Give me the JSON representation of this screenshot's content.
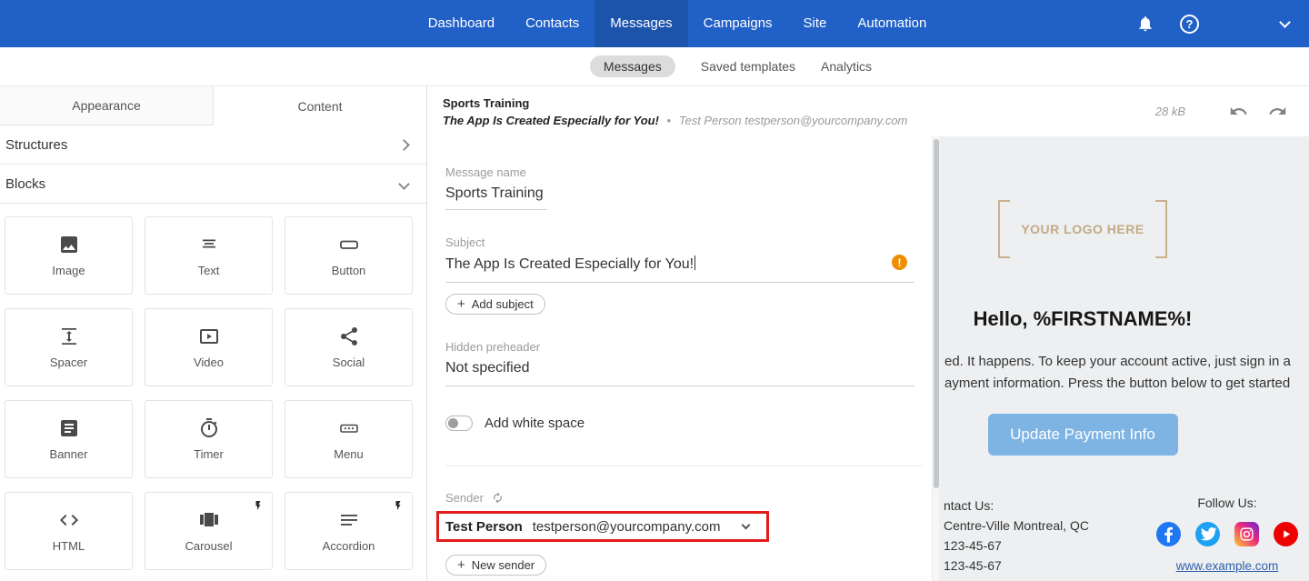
{
  "colors": {
    "topnav_bg": "#2160c7",
    "topnav_active_bg": "#1c53ab",
    "active_pill_bg": "#dcdcdc",
    "warning_orange": "#ef8e00",
    "highlight_red": "#e31b1b",
    "cta_button_blue": "#7db4e4",
    "logo_tan": "#c2ab84",
    "link_blue": "#3060ad",
    "facebook_blue": "#1f77f2",
    "twitter_blue": "#1da1f2",
    "youtube_red": "#ee0000"
  },
  "icons": {
    "plus": "+",
    "question": "?",
    "exclamation": "!",
    "bullet": "•"
  },
  "top_nav": {
    "items": [
      {
        "label": "Dashboard",
        "active": false
      },
      {
        "label": "Contacts",
        "active": false
      },
      {
        "label": "Messages",
        "active": true
      },
      {
        "label": "Campaigns",
        "active": false
      },
      {
        "label": "Site",
        "active": false
      },
      {
        "label": "Automation",
        "active": false
      }
    ]
  },
  "sub_nav": {
    "items": [
      {
        "label": "Messages",
        "active": true
      },
      {
        "label": "Saved templates",
        "active": false
      },
      {
        "label": "Analytics",
        "active": false
      }
    ]
  },
  "left_panel": {
    "tabs": [
      {
        "label": "Appearance",
        "active": false
      },
      {
        "label": "Content",
        "active": true
      }
    ],
    "sections": [
      {
        "label": "Structures",
        "state": "collapsed"
      },
      {
        "label": "Blocks",
        "state": "expanded"
      }
    ],
    "blocks": [
      {
        "label": "Image"
      },
      {
        "label": "Text"
      },
      {
        "label": "Button"
      },
      {
        "label": "Spacer"
      },
      {
        "label": "Video"
      },
      {
        "label": "Social"
      },
      {
        "label": "Banner"
      },
      {
        "label": "Timer"
      },
      {
        "label": "Menu"
      },
      {
        "label": "HTML"
      },
      {
        "label": "Carousel",
        "flash": true
      },
      {
        "label": "Accordion",
        "flash": true
      }
    ]
  },
  "message_header": {
    "title": "Sports Training",
    "subject_preview": "The App Is Created Especially for You!",
    "sender_preview": "Test Person testperson@yourcompany.com",
    "size": "28 kB"
  },
  "form": {
    "message_name": {
      "label": "Message name",
      "value": "Sports Training"
    },
    "subject": {
      "label": "Subject",
      "value": "The App Is Created Especially for You!"
    },
    "add_subject_label": "Add subject",
    "preheader": {
      "label": "Hidden preheader",
      "value": "Not specified"
    },
    "white_space_label": "Add white space",
    "white_space_on": false,
    "sender": {
      "label": "Sender",
      "name": "Test Person",
      "email": "testperson@yourcompany.com"
    },
    "new_sender_label": "New sender"
  },
  "preview": {
    "logo_text": "YOUR LOGO HERE",
    "heading": "Hello, %FIRSTNAME%!",
    "body_lines": [
      "ed. It happens. To keep your account active, just sign in a",
      "ayment information. Press the button below to get started"
    ],
    "button_label": "Update Payment Info",
    "contact_lines": [
      "ntact Us:",
      "Centre-Ville Montreal, QC",
      "123-45-67",
      "123-45-67"
    ],
    "follow_label": "Follow Us:",
    "website_link": "www.example.com",
    "social": [
      "facebook",
      "twitter",
      "instagram",
      "youtube"
    ]
  }
}
